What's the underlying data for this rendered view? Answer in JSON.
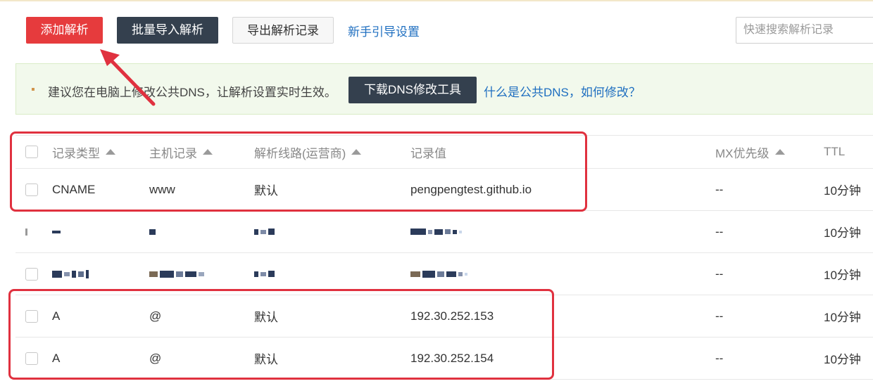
{
  "toolbar": {
    "add_label": "添加解析",
    "batch_import_label": "批量导入解析",
    "export_label": "导出解析记录",
    "guide_link": "新手引导设置",
    "search_placeholder": "快速搜索解析记录"
  },
  "notice": {
    "text": "建议您在电脑上修改公共DNS，让解析设置实时生效。",
    "download_button": "下载DNS修改工具",
    "help_link": "什么是公共DNS，如何修改？"
  },
  "table": {
    "headers": {
      "type": "记录类型",
      "host": "主机记录",
      "line": "解析线路(运营商)",
      "value": "记录值",
      "mx": "MX优先级",
      "ttl": "TTL"
    },
    "rows": [
      {
        "type": "CNAME",
        "host": "www",
        "line": "默认",
        "value": "pengpengtest.github.io",
        "mx": "--",
        "ttl": "10分钟"
      },
      {
        "mx": "--",
        "ttl": "10分钟"
      },
      {
        "mx": "--",
        "ttl": "10分钟"
      },
      {
        "type": "A",
        "host": "@",
        "line": "默认",
        "value": "192.30.252.153",
        "mx": "--",
        "ttl": "10分钟"
      },
      {
        "type": "A",
        "host": "@",
        "line": "默认",
        "value": "192.30.252.154",
        "mx": "--",
        "ttl": "10分钟"
      }
    ]
  },
  "colors": {
    "primary_red": "#e63b3d",
    "dark_button": "#34404e",
    "link_blue": "#1f6fc0",
    "annotation_red": "#e0313f",
    "notice_bg": "#f2f9ec"
  },
  "icons": [
    "sort-asc-icon",
    "checkbox-icon",
    "annotation-arrow-icon"
  ]
}
